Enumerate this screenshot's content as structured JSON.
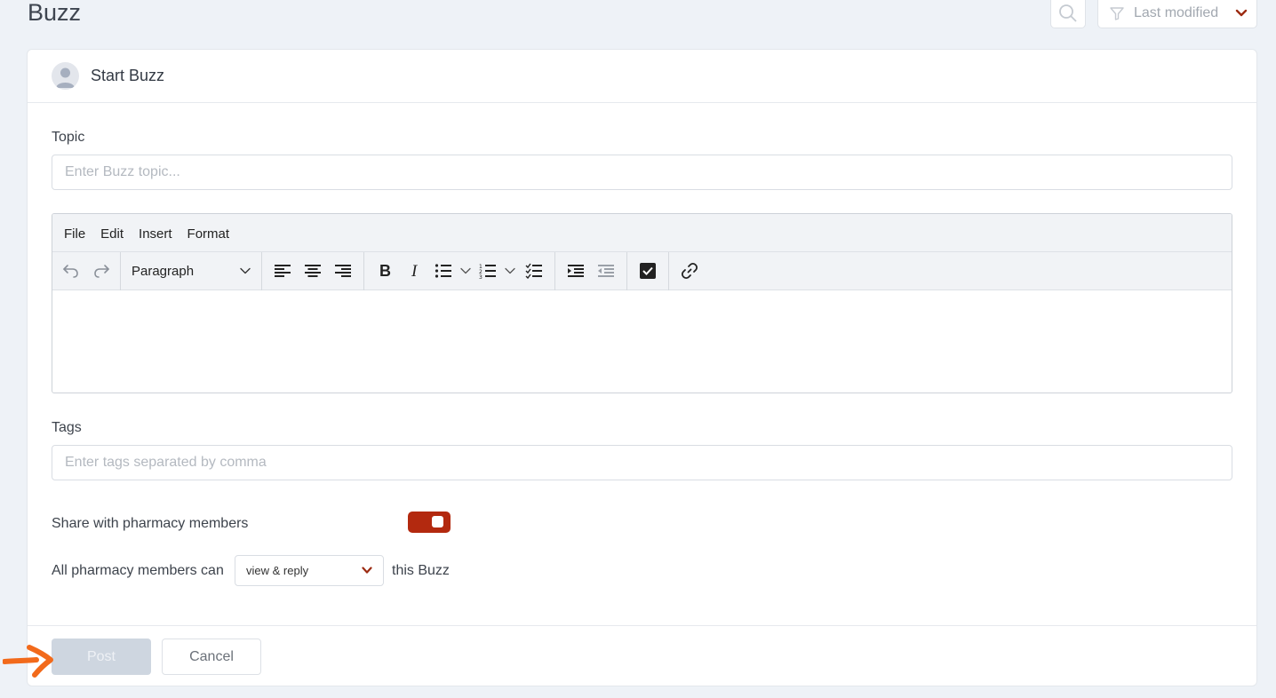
{
  "page": {
    "title": "Buzz"
  },
  "toolbar": {
    "sort_label": "Last modified"
  },
  "card": {
    "header_title": "Start Buzz",
    "topic": {
      "label": "Topic",
      "placeholder": "Enter Buzz topic..."
    },
    "editor": {
      "menu": [
        "File",
        "Edit",
        "Insert",
        "Format"
      ],
      "block_format": "Paragraph"
    },
    "tags": {
      "label": "Tags",
      "placeholder": "Enter tags separated by comma"
    },
    "share": {
      "label": "Share with pharmacy members",
      "enabled": true
    },
    "permission": {
      "prefix": "All pharmacy members can",
      "selected": "view & reply",
      "suffix": "this Buzz"
    },
    "actions": {
      "post_label": "Post",
      "cancel_label": "Cancel"
    }
  },
  "colors": {
    "accent": "#b3290f",
    "annotation_arrow": "#f26a1b"
  }
}
